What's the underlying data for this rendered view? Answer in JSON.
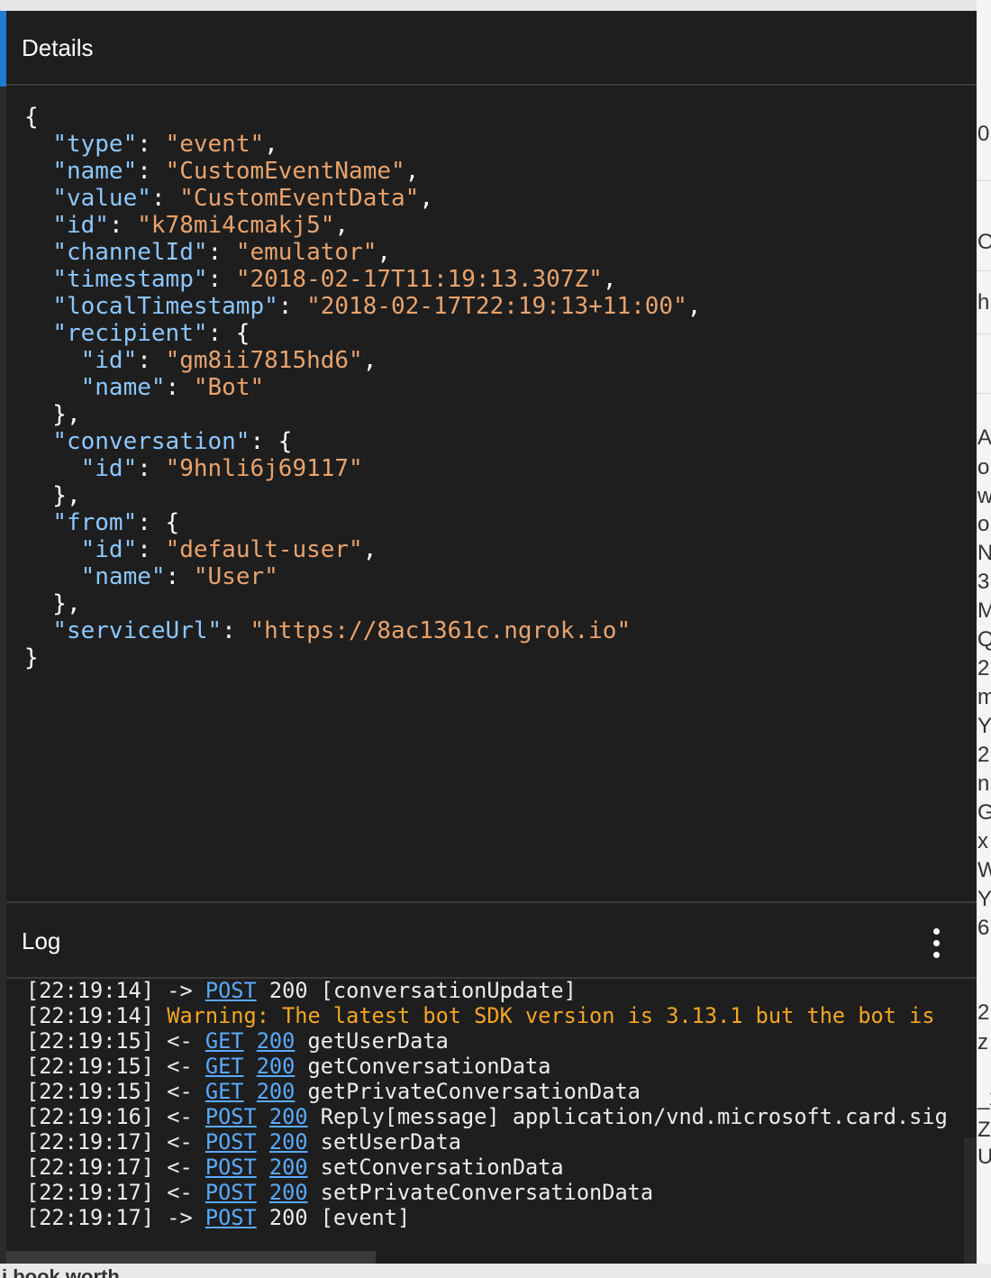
{
  "details": {
    "title": "Details",
    "json_lines": [
      [
        {
          "t": "{"
        }
      ],
      [
        {
          "t": "  "
        },
        {
          "t": "\"type\"",
          "c": "k"
        },
        {
          "t": ": "
        },
        {
          "t": "\"event\"",
          "c": "s"
        },
        {
          "t": ","
        }
      ],
      [
        {
          "t": "  "
        },
        {
          "t": "\"name\"",
          "c": "k"
        },
        {
          "t": ": "
        },
        {
          "t": "\"CustomEventName\"",
          "c": "s"
        },
        {
          "t": ","
        }
      ],
      [
        {
          "t": "  "
        },
        {
          "t": "\"value\"",
          "c": "k"
        },
        {
          "t": ": "
        },
        {
          "t": "\"CustomEventData\"",
          "c": "s"
        },
        {
          "t": ","
        }
      ],
      [
        {
          "t": "  "
        },
        {
          "t": "\"id\"",
          "c": "k"
        },
        {
          "t": ": "
        },
        {
          "t": "\"k78mi4cmakj5\"",
          "c": "s"
        },
        {
          "t": ","
        }
      ],
      [
        {
          "t": "  "
        },
        {
          "t": "\"channelId\"",
          "c": "k"
        },
        {
          "t": ": "
        },
        {
          "t": "\"emulator\"",
          "c": "s"
        },
        {
          "t": ","
        }
      ],
      [
        {
          "t": "  "
        },
        {
          "t": "\"timestamp\"",
          "c": "k"
        },
        {
          "t": ": "
        },
        {
          "t": "\"2018-02-17T11:19:13.307Z\"",
          "c": "s"
        },
        {
          "t": ","
        }
      ],
      [
        {
          "t": "  "
        },
        {
          "t": "\"localTimestamp\"",
          "c": "k"
        },
        {
          "t": ": "
        },
        {
          "t": "\"2018-02-17T22:19:13+11:00\"",
          "c": "s"
        },
        {
          "t": ","
        }
      ],
      [
        {
          "t": "  "
        },
        {
          "t": "\"recipient\"",
          "c": "k"
        },
        {
          "t": ": {"
        }
      ],
      [
        {
          "t": "    "
        },
        {
          "t": "\"id\"",
          "c": "k"
        },
        {
          "t": ": "
        },
        {
          "t": "\"gm8ii7815hd6\"",
          "c": "s"
        },
        {
          "t": ","
        }
      ],
      [
        {
          "t": "    "
        },
        {
          "t": "\"name\"",
          "c": "k"
        },
        {
          "t": ": "
        },
        {
          "t": "\"Bot\"",
          "c": "s"
        }
      ],
      [
        {
          "t": "  },"
        }
      ],
      [
        {
          "t": "  "
        },
        {
          "t": "\"conversation\"",
          "c": "k"
        },
        {
          "t": ": {"
        }
      ],
      [
        {
          "t": "    "
        },
        {
          "t": "\"id\"",
          "c": "k"
        },
        {
          "t": ": "
        },
        {
          "t": "\"9hnli6j69117\"",
          "c": "s"
        }
      ],
      [
        {
          "t": "  },"
        }
      ],
      [
        {
          "t": "  "
        },
        {
          "t": "\"from\"",
          "c": "k"
        },
        {
          "t": ": {"
        }
      ],
      [
        {
          "t": "    "
        },
        {
          "t": "\"id\"",
          "c": "k"
        },
        {
          "t": ": "
        },
        {
          "t": "\"default-user\"",
          "c": "s"
        },
        {
          "t": ","
        }
      ],
      [
        {
          "t": "    "
        },
        {
          "t": "\"name\"",
          "c": "k"
        },
        {
          "t": ": "
        },
        {
          "t": "\"User\"",
          "c": "s"
        }
      ],
      [
        {
          "t": "  },"
        }
      ],
      [
        {
          "t": "  "
        },
        {
          "t": "\"serviceUrl\"",
          "c": "k"
        },
        {
          "t": ": "
        },
        {
          "t": "\"https://8ac1361c.ngrok.io\"",
          "c": "s"
        }
      ],
      [
        {
          "t": "}"
        }
      ]
    ]
  },
  "log": {
    "title": "Log",
    "menu_icon": "kebab-menu-icon",
    "entries": [
      [
        {
          "t": "[22:19:14] -> "
        },
        {
          "t": "POST",
          "link": true
        },
        {
          "t": " 200 [conversationUpdate]"
        }
      ],
      [
        {
          "t": "[22:19:14] "
        },
        {
          "t": "Warning: The latest bot SDK version is 3.13.1 but the bot is",
          "c": "warn"
        }
      ],
      [
        {
          "t": "[22:19:15] <- "
        },
        {
          "t": "GET",
          "link": true
        },
        {
          "t": " "
        },
        {
          "t": "200",
          "link": true
        },
        {
          "t": " getUserData"
        }
      ],
      [
        {
          "t": "[22:19:15] <- "
        },
        {
          "t": "GET",
          "link": true
        },
        {
          "t": " "
        },
        {
          "t": "200",
          "link": true
        },
        {
          "t": " getConversationData"
        }
      ],
      [
        {
          "t": "[22:19:15] <- "
        },
        {
          "t": "GET",
          "link": true
        },
        {
          "t": " "
        },
        {
          "t": "200",
          "link": true
        },
        {
          "t": " getPrivateConversationData"
        }
      ],
      [
        {
          "t": "[22:19:16] <- "
        },
        {
          "t": "POST",
          "link": true
        },
        {
          "t": " "
        },
        {
          "t": "200",
          "link": true
        },
        {
          "t": " Reply[message] application/vnd.microsoft.card.sig"
        }
      ],
      [
        {
          "t": "[22:19:17] <- "
        },
        {
          "t": "POST",
          "link": true
        },
        {
          "t": " "
        },
        {
          "t": "200",
          "link": true
        },
        {
          "t": " setUserData"
        }
      ],
      [
        {
          "t": "[22:19:17] <- "
        },
        {
          "t": "POST",
          "link": true
        },
        {
          "t": " "
        },
        {
          "t": "200",
          "link": true
        },
        {
          "t": " setConversationData"
        }
      ],
      [
        {
          "t": "[22:19:17] <- "
        },
        {
          "t": "POST",
          "link": true
        },
        {
          "t": " "
        },
        {
          "t": "200",
          "link": true
        },
        {
          "t": " setPrivateConversationData"
        }
      ],
      [
        {
          "t": "[22:19:17] -> "
        },
        {
          "t": "POST",
          "link": true
        },
        {
          "t": " 200 [event]"
        }
      ]
    ]
  },
  "background": {
    "right_fragments": [
      "0",
      "O",
      "h",
      "A",
      "o",
      "w",
      "o",
      "N",
      "3",
      "M",
      "Q",
      "2",
      "m",
      "Y",
      "2",
      "n",
      "G",
      "x",
      "W",
      "Y",
      "6",
      "2",
      "z",
      "_x",
      "Z",
      "U"
    ],
    "bottom_fragment": "i book worth"
  },
  "colors": {
    "panel_bg": "#1e1e1e",
    "json_key": "#8cc7ff",
    "json_string": "#e9a36d",
    "link": "#5aaaff",
    "warning": "#f5a623",
    "accent": "#1e7bd6"
  }
}
